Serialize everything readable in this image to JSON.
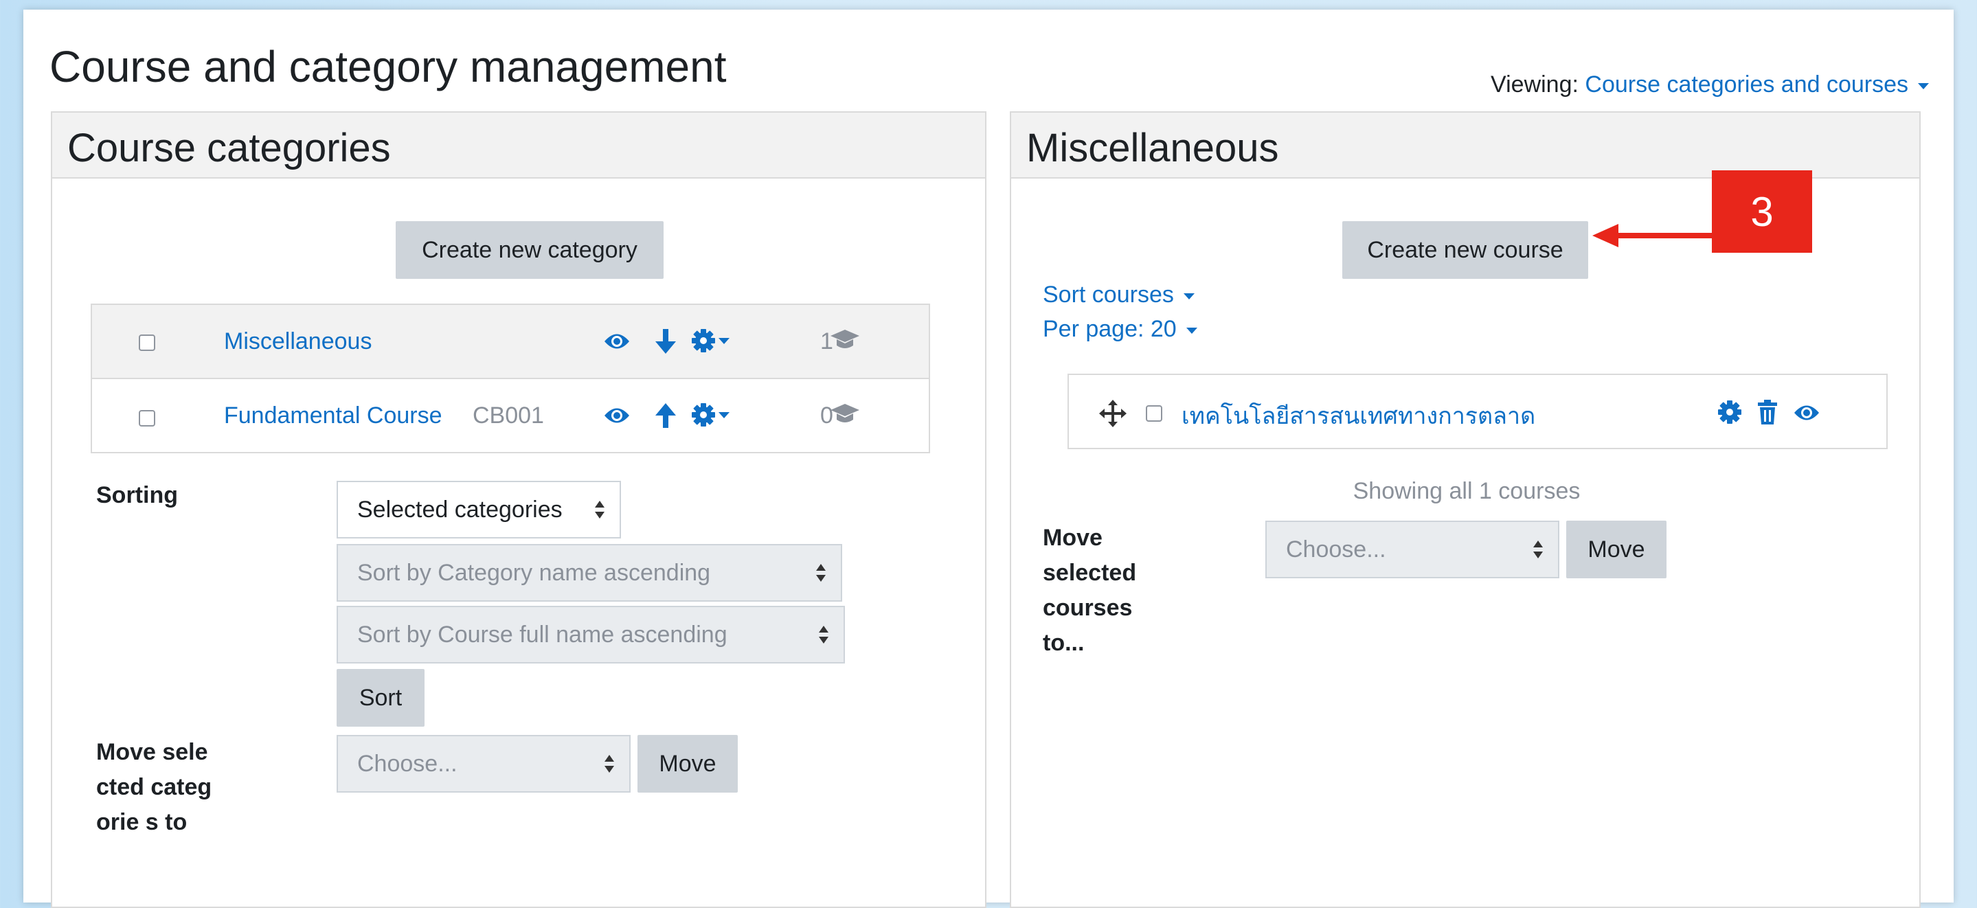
{
  "page": {
    "title": "Course and category management",
    "viewing_label": "Viewing:",
    "viewing_value": "Course categories and courses"
  },
  "categories_panel": {
    "title": "Course categories",
    "create_button": "Create new category",
    "rows": [
      {
        "name": "Miscellaneous",
        "idnumber": "",
        "count": "1"
      },
      {
        "name": "Fundamental Course",
        "idnumber": "CB001",
        "count": "0"
      }
    ],
    "sorting_label": "Sorting",
    "sort_scope_select": "Selected categories",
    "sort_category_select": "Sort by Category name ascending",
    "sort_course_select": "Sort by Course full name ascending",
    "sort_button": "Sort",
    "move_label": "Move selected categorie s to",
    "move_select": "Choose...",
    "move_button": "Move"
  },
  "courses_panel": {
    "title": "Miscellaneous",
    "create_button": "Create new course",
    "sort_courses": "Sort courses",
    "per_page": "Per page: 20",
    "courses": [
      {
        "name": "เทคโนโลยีสารสนเทศทางการตลาด"
      }
    ],
    "showing": "Showing all 1 courses",
    "move_label": "Move selected courses to...",
    "move_select": "Choose...",
    "move_button": "Move"
  },
  "callout": {
    "number": "3",
    "color": "#e8261b"
  },
  "colors": {
    "link": "#0f6fc5",
    "button_bg": "#ced4da",
    "header_bg": "#f2f2f2",
    "page_bg": "#cfe7f8"
  },
  "icons": [
    "eye-icon",
    "arrow-down-icon",
    "arrow-up-icon",
    "gear-icon",
    "graduation-cap-icon",
    "move-icon",
    "trash-icon"
  ]
}
